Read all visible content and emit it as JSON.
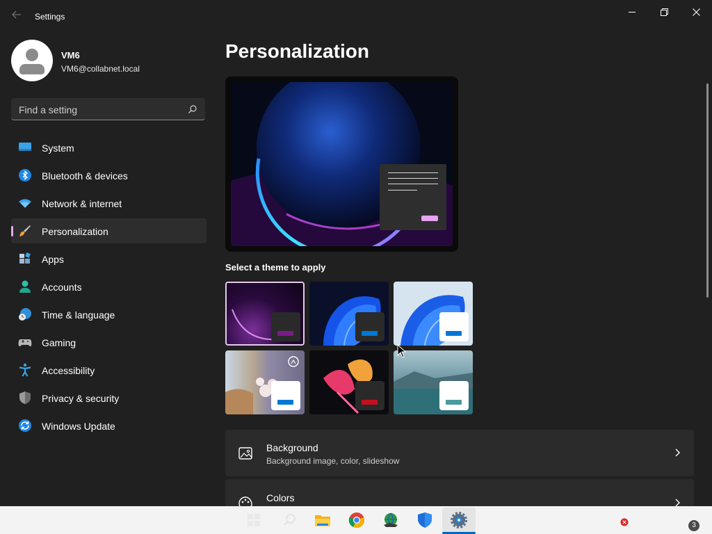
{
  "window": {
    "title": "Settings",
    "back_icon": "back-arrow-icon",
    "controls": [
      "minimize-icon",
      "maximize-icon",
      "close-icon"
    ]
  },
  "user": {
    "name": "VM6",
    "email": "VM6@collabnet.local"
  },
  "search": {
    "placeholder": "Find a setting",
    "icon": "search-icon"
  },
  "sidebar": {
    "items": [
      {
        "label": "System",
        "icon": "system-monitor-icon",
        "active": false
      },
      {
        "label": "Bluetooth & devices",
        "icon": "bluetooth-icon",
        "active": false
      },
      {
        "label": "Network & internet",
        "icon": "wifi-icon",
        "active": false
      },
      {
        "label": "Personalization",
        "icon": "paintbrush-icon",
        "active": true
      },
      {
        "label": "Apps",
        "icon": "apps-icon",
        "active": false
      },
      {
        "label": "Accounts",
        "icon": "account-icon",
        "active": false
      },
      {
        "label": "Time & language",
        "icon": "globe-clock-icon",
        "active": false
      },
      {
        "label": "Gaming",
        "icon": "gamepad-icon",
        "active": false
      },
      {
        "label": "Accessibility",
        "icon": "accessibility-icon",
        "active": false
      },
      {
        "label": "Privacy & security",
        "icon": "shield-icon",
        "active": false
      },
      {
        "label": "Windows Update",
        "icon": "update-icon",
        "active": false
      }
    ]
  },
  "main": {
    "title": "Personalization",
    "theme_section_label": "Select a theme to apply",
    "themes": [
      {
        "name": "windows-dark-glow",
        "selected": true,
        "accent": "#7a1b8a"
      },
      {
        "name": "windows-dark-bloom",
        "selected": false,
        "accent": "#0078d4"
      },
      {
        "name": "windows-light-bloom",
        "selected": false,
        "accent": "#0078d4"
      },
      {
        "name": "windows-spotlight",
        "selected": false,
        "accent": "#0078d4"
      },
      {
        "name": "captured-motion",
        "selected": false,
        "accent": "#c50f1f"
      },
      {
        "name": "flow",
        "selected": false,
        "accent": "#4a9a9e"
      }
    ],
    "cards": [
      {
        "title": "Background",
        "subtitle": "Background image, color, slideshow",
        "icon": "image-icon"
      },
      {
        "title": "Colors",
        "subtitle": "",
        "icon": "palette-icon"
      }
    ]
  },
  "taskbar": {
    "apps": [
      "start-icon",
      "search-icon",
      "file-explorer-icon",
      "chrome-icon",
      "network-globe-icon",
      "defender-shield-icon",
      "settings-gear-icon"
    ],
    "active_app": "settings-gear-icon",
    "notification_count": "3"
  },
  "colors": {
    "background": "#202020",
    "accent": "#e5a8ef",
    "card": "#2b2b2b"
  }
}
